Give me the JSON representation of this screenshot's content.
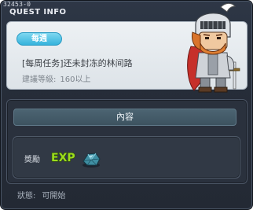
{
  "window": {
    "quest_id": "32453-0",
    "title": "QUEST INFO"
  },
  "quest": {
    "category_badge": "每週",
    "name": "[每周任务]还未封冻的林间路",
    "level_label": "建議等級:",
    "level_value": "160以上"
  },
  "content": {
    "header": "內容",
    "reward_label": "獎勵",
    "rewards": [
      {
        "icon": "exp-icon",
        "text": "EXP"
      },
      {
        "icon": "gem-ore-icon"
      }
    ]
  },
  "status": {
    "label": "狀態:",
    "value": "可開始"
  },
  "colors": {
    "window_bg": "#262d39",
    "panel_light": "#e6ebef",
    "badge": "#35b3dc",
    "exp_green": "#9bdc1e",
    "header_bar": "#456070"
  }
}
